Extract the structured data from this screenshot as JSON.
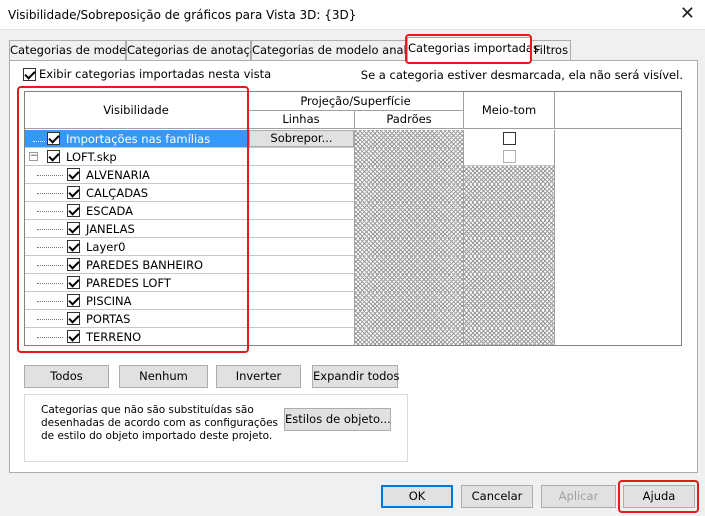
{
  "window": {
    "title": "Visibilidade/Sobreposição de gráficos para Vista 3D: {3D}"
  },
  "tabs": [
    {
      "label": "Categorias de modelo"
    },
    {
      "label": "Categorias de anotação"
    },
    {
      "label": "Categorias de modelo analítico"
    },
    {
      "label": "Categorias importadas"
    },
    {
      "label": "Filtros"
    }
  ],
  "show_imported": {
    "label": "Exibir categorias importadas nesta vista",
    "checked": true
  },
  "hint": "Se a categoria estiver desmarcada, ela não será visível.",
  "grid": {
    "headers": {
      "visibility": "Visibilidade",
      "projection_surface": "Projeção/Superfície",
      "lines": "Linhas",
      "patterns": "Padrões",
      "halftone": "Meio-tom"
    },
    "override_label": "Sobrepor...",
    "rows": [
      {
        "label": "Importações nas famílias",
        "checked": true,
        "level": 0,
        "selected": true
      },
      {
        "label": "LOFT.skp",
        "checked": true,
        "level": 0,
        "selected": false
      },
      {
        "label": "ALVENARIA",
        "checked": true,
        "level": 1
      },
      {
        "label": "CALÇADAS",
        "checked": true,
        "level": 1
      },
      {
        "label": "ESCADA",
        "checked": true,
        "level": 1
      },
      {
        "label": "JANELAS",
        "checked": true,
        "level": 1
      },
      {
        "label": "Layer0",
        "checked": true,
        "level": 1
      },
      {
        "label": "PAREDES BANHEIRO",
        "checked": true,
        "level": 1
      },
      {
        "label": "PAREDES LOFT",
        "checked": true,
        "level": 1
      },
      {
        "label": "PISCINA",
        "checked": true,
        "level": 1
      },
      {
        "label": "PORTAS",
        "checked": true,
        "level": 1
      },
      {
        "label": "TERRENO",
        "checked": true,
        "level": 1
      }
    ]
  },
  "actions": {
    "all": "Todos",
    "none": "Nenhum",
    "invert": "Inverter",
    "expand_all": "Expandir todos"
  },
  "info": {
    "text": "Categorias que não são substituídas são desenhadas de acordo com as configurações de estilo do objeto importado deste projeto.",
    "object_styles": "Estilos de objeto..."
  },
  "footer": {
    "ok": "OK",
    "cancel": "Cancelar",
    "apply": "Aplicar",
    "help": "Ajuda"
  }
}
